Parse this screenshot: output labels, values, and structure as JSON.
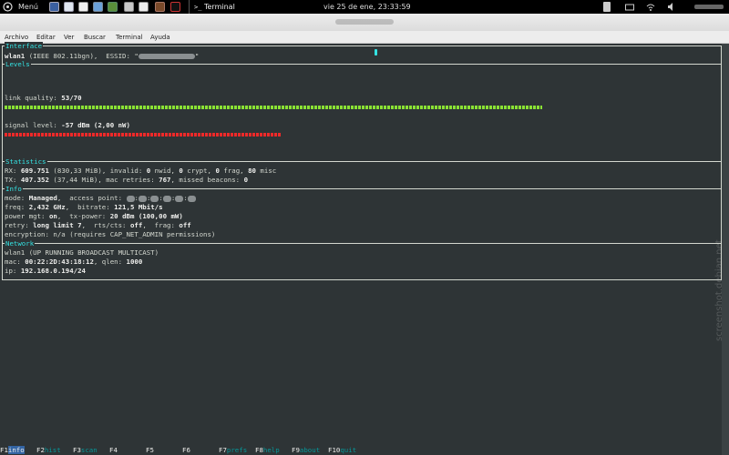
{
  "top_panel": {
    "menu_label": "Menú",
    "terminal_label": "Terminal",
    "datetime": "vie 25 de ene, 23:33:59",
    "launchers": [
      "terminal-app",
      "mail-app",
      "text-editor",
      "image-viewer",
      "tools-app",
      "archive-app",
      "disk-utility",
      "media-app",
      "terminal-app-2"
    ]
  },
  "menubar": {
    "items": [
      "Archivo",
      "Editar",
      "Ver",
      "Buscar",
      "Terminal",
      "Ayuda"
    ]
  },
  "wavemon": {
    "sections": {
      "interface": "Interface",
      "levels": "Levels",
      "statistics": "Statistics",
      "info": "Info",
      "network": "Network"
    },
    "interface": {
      "name": "wlan1",
      "desc": "(IEEE 802.11bgn),  ESSID: \"",
      "essid_close": "\""
    },
    "levels": {
      "link_label": "link quality: ",
      "link_value": "53/70",
      "link_fraction": 0.757,
      "signal_label": "signal level: ",
      "signal_value": "-57 dBm (2,00 nW)",
      "signal_fraction": 0.52
    },
    "statistics": {
      "rx_label": "RX: ",
      "rx_pkts": "609.751",
      "rx_size": " (830,33 MiB)",
      "rx_mid1": ", invalid: ",
      "rx_invalid": "0",
      "rx_mid2": " nwid, ",
      "rx_crypt": "0",
      "rx_mid3": " crypt, ",
      "rx_frag": "0",
      "rx_mid4": " frag, ",
      "rx_misc": "80",
      "rx_end": " misc",
      "tx_label": "TX: ",
      "tx_pkts": "407.352",
      "tx_size": " (37,44 MiB)",
      "tx_mid1": ", mac retries: ",
      "tx_retries": "767",
      "tx_mid2": ", missed beacons: ",
      "tx_missed": "0"
    },
    "info": {
      "mode_label": "mode: ",
      "mode": "Managed",
      "ap_label": ",  access point: ",
      "freq_label": "freq: ",
      "freq": "2,432 GHz",
      "bitrate_label": ",  bitrate: ",
      "bitrate": "121,5 Mbit/s",
      "pm_label": "power mgt: ",
      "pm": "on",
      "txp_label": ",  tx-power: ",
      "txp": "20 dBm (100,00 mW)",
      "retry_label": "retry: ",
      "retry": "long limit 7",
      "rts_label": ",  rts/cts: ",
      "rts": "off",
      "frag_label": ",  frag: ",
      "frag": "off",
      "enc_line": "encryption: n/a (requires CAP_NET_ADMIN permissions)"
    },
    "network": {
      "iface_line": "wlan1 (UP RUNNING BROADCAST MULTICAST)",
      "mac_label": "mac: ",
      "mac": "00:22:2D:43:18:12",
      "qlen_label": ", qlen: ",
      "qlen": "1000",
      "ip_label": "ip: ",
      "ip": "192.168.0.194/24"
    },
    "fkeys": [
      {
        "key": "F1",
        "label": "info"
      },
      {
        "key": "F2",
        "label": "hist"
      },
      {
        "key": "F3",
        "label": "scan"
      },
      {
        "key": "F4",
        "label": ""
      },
      {
        "key": "F5",
        "label": ""
      },
      {
        "key": "F6",
        "label": ""
      },
      {
        "key": "F7",
        "label": "prefs"
      },
      {
        "key": "F8",
        "label": "help"
      },
      {
        "key": "F9",
        "label": "about"
      },
      {
        "key": "F10",
        "label": "quit"
      }
    ]
  },
  "watermark": "screenshot.debian.net",
  "colors": {
    "terminal_bg": "#2e3436",
    "section_label": "#06989a",
    "link_bar": "#8ae234",
    "signal_bar": "#ef2929"
  }
}
